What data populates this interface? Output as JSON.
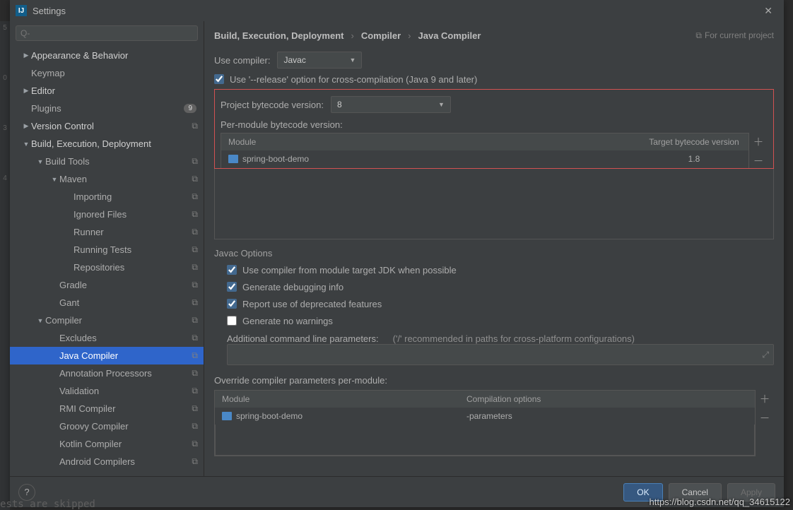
{
  "window": {
    "title": "Settings"
  },
  "search": {
    "placeholder": "Q-"
  },
  "nav": {
    "items": [
      {
        "label": "Appearance & Behavior",
        "depth": 0,
        "expand": "▶",
        "strong": true
      },
      {
        "label": "Keymap",
        "depth": 0
      },
      {
        "label": "Editor",
        "depth": 0,
        "expand": "▶",
        "strong": true
      },
      {
        "label": "Plugins",
        "depth": 0,
        "badge": "9"
      },
      {
        "label": "Version Control",
        "depth": 0,
        "expand": "▶",
        "strong": true,
        "reset": true
      },
      {
        "label": "Build, Execution, Deployment",
        "depth": 0,
        "expand": "▼",
        "strong": true
      },
      {
        "label": "Build Tools",
        "depth": 1,
        "expand": "▼",
        "reset": true
      },
      {
        "label": "Maven",
        "depth": 2,
        "expand": "▼",
        "reset": true
      },
      {
        "label": "Importing",
        "depth": 3,
        "reset": true
      },
      {
        "label": "Ignored Files",
        "depth": 3,
        "reset": true
      },
      {
        "label": "Runner",
        "depth": 3,
        "reset": true
      },
      {
        "label": "Running Tests",
        "depth": 3,
        "reset": true
      },
      {
        "label": "Repositories",
        "depth": 3,
        "reset": true
      },
      {
        "label": "Gradle",
        "depth": 2,
        "reset": true
      },
      {
        "label": "Gant",
        "depth": 2,
        "reset": true
      },
      {
        "label": "Compiler",
        "depth": 1,
        "expand": "▼",
        "reset": true
      },
      {
        "label": "Excludes",
        "depth": 2,
        "reset": true
      },
      {
        "label": "Java Compiler",
        "depth": 2,
        "reset": true,
        "selected": true
      },
      {
        "label": "Annotation Processors",
        "depth": 2,
        "reset": true
      },
      {
        "label": "Validation",
        "depth": 2,
        "reset": true
      },
      {
        "label": "RMI Compiler",
        "depth": 2,
        "reset": true
      },
      {
        "label": "Groovy Compiler",
        "depth": 2,
        "reset": true
      },
      {
        "label": "Kotlin Compiler",
        "depth": 2,
        "reset": true
      },
      {
        "label": "Android Compilers",
        "depth": 2,
        "reset": true
      }
    ]
  },
  "breadcrumb": {
    "a": "Build, Execution, Deployment",
    "b": "Compiler",
    "c": "Java Compiler",
    "ctx": "For current project"
  },
  "compilerForm": {
    "useCompilerLabel": "Use compiler:",
    "useCompilerValue": "Javac",
    "releaseOpt": "Use '--release' option for cross-compilation (Java 9 and later)",
    "projByteLabel": "Project bytecode version:",
    "projByteValue": "8",
    "perModuleLabel": "Per-module bytecode version:",
    "colModule": "Module",
    "colTarget": "Target bytecode version",
    "row": {
      "module": "spring-boot-demo",
      "target": "1.8"
    }
  },
  "javacOptions": {
    "title": "Javac Options",
    "opt1": "Use compiler from module target JDK when possible",
    "opt2": "Generate debugging info",
    "opt3": "Report use of deprecated features",
    "opt4": "Generate no warnings",
    "addlLabel": "Additional command line parameters:",
    "addlHint": "('/' recommended in paths for cross-platform configurations)"
  },
  "override": {
    "title": "Override compiler parameters per-module:",
    "colModule": "Module",
    "colOpts": "Compilation options",
    "row": {
      "module": "spring-boot-demo",
      "opts": "-parameters"
    }
  },
  "buttons": {
    "ok": "OK",
    "cancel": "Cancel",
    "apply": "Apply"
  },
  "watermark": "https://blog.csdn.net/qq_34615122",
  "bottomStrip": "ests are skipped"
}
